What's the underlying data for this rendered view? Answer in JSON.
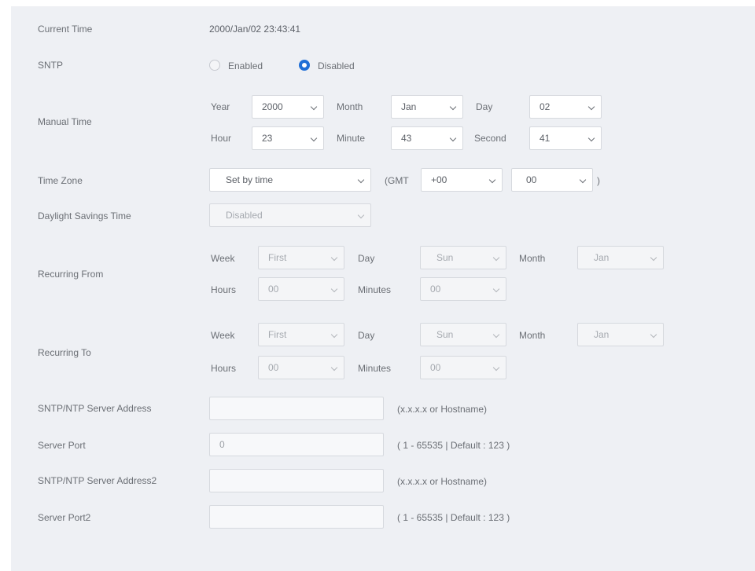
{
  "current_time": {
    "label": "Current Time",
    "value": "2000/Jan/02 23:43:41"
  },
  "sntp": {
    "label": "SNTP",
    "enabled_label": "Enabled",
    "disabled_label": "Disabled",
    "selected": "Disabled"
  },
  "manual_time": {
    "label": "Manual Time",
    "year_label": "Year",
    "year": "2000",
    "month_label": "Month",
    "month": "Jan",
    "day_label": "Day",
    "day": "02",
    "hour_label": "Hour",
    "hour": "23",
    "minute_label": "Minute",
    "minute": "43",
    "second_label": "Second",
    "second": "41"
  },
  "time_zone": {
    "label": "Time Zone",
    "value": "Set by time",
    "gmt_open": "(GMT",
    "gmt_hours": "+00",
    "gmt_minutes": "00",
    "gmt_close": ")"
  },
  "dst": {
    "label": "Daylight Savings Time",
    "value": "Disabled"
  },
  "recurring_from": {
    "label": "Recurring From",
    "week_label": "Week",
    "week": "First",
    "day_label": "Day",
    "day": "Sun",
    "month_label": "Month",
    "month": "Jan",
    "hours_label": "Hours",
    "hours": "00",
    "minutes_label": "Minutes",
    "minutes": "00"
  },
  "recurring_to": {
    "label": "Recurring To",
    "week_label": "Week",
    "week": "First",
    "day_label": "Day",
    "day": "Sun",
    "month_label": "Month",
    "month": "Jan",
    "hours_label": "Hours",
    "hours": "00",
    "minutes_label": "Minutes",
    "minutes": "00"
  },
  "server_address": {
    "label": "SNTP/NTP Server Address",
    "value": "",
    "hint": "(x.x.x.x or Hostname)"
  },
  "server_port": {
    "label": "Server Port",
    "value": "0",
    "hint": "( 1 - 65535 | Default : 123 )"
  },
  "server_address2": {
    "label": "SNTP/NTP Server Address2",
    "value": "",
    "hint": "(x.x.x.x or Hostname)"
  },
  "server_port2": {
    "label": "Server Port2",
    "value": "",
    "hint": "( 1 - 65535 | Default : 123 )"
  }
}
